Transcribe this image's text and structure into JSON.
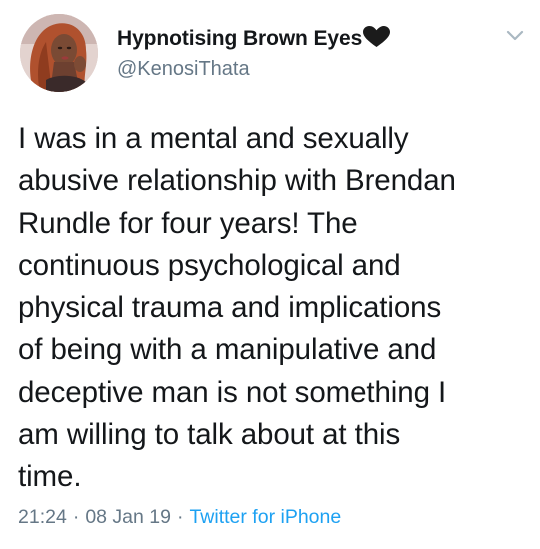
{
  "author": {
    "display_name": "Hypnotising Brown Eyes",
    "handle": "@KenosiThata"
  },
  "icons": {
    "name_emoji": "black-heart-icon",
    "menu": "chevron-down-icon",
    "avatar": "profile-photo"
  },
  "tweet": {
    "text": "I was in a mental and sexually\nabusive relationship with Brendan\nRundle for four years! The\ncontinuous psychological and\nphysical trauma and implications\nof being with a manipulative and\ndeceptive man is not something I\nam willing to talk about at this\ntime.",
    "time": "21:24",
    "separator": "·",
    "date": "08 Jan 19",
    "source": "Twitter for iPhone"
  },
  "colors": {
    "text": "#14171a",
    "secondary": "#657786",
    "link": "#1da1f2",
    "caret": "#aab8c2"
  }
}
